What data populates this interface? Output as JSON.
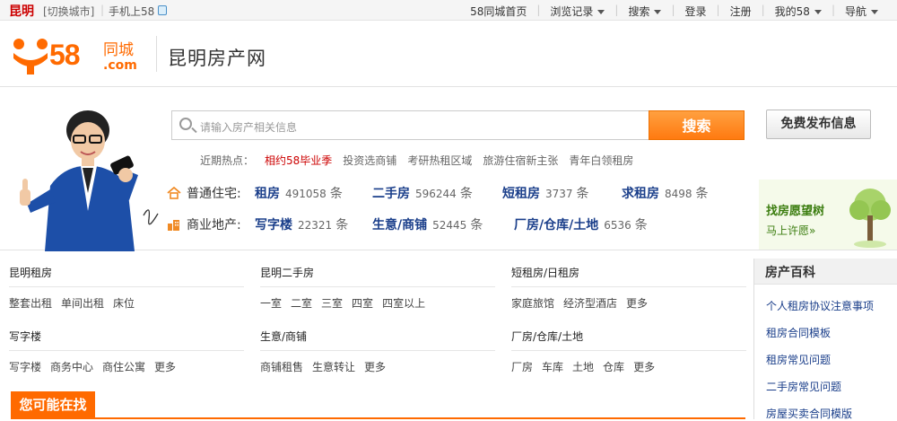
{
  "topbar": {
    "city": "昆明",
    "switch_city": "[切换城市]",
    "mobile": "手机上58",
    "right_items": [
      {
        "label": "58同城首页",
        "caret": false
      },
      {
        "label": "浏览记录",
        "caret": true
      },
      {
        "label": "搜索",
        "caret": true
      },
      {
        "label": "登录",
        "caret": false
      },
      {
        "label": "注册",
        "caret": false
      },
      {
        "label": "我的58",
        "caret": true
      },
      {
        "label": "导航",
        "caret": true
      }
    ]
  },
  "header": {
    "logo_brand": "58",
    "logo_cn": "同城",
    "logo_dotcom": ".com",
    "site_title": "昆明房产网"
  },
  "search": {
    "placeholder": "请输入房产相关信息",
    "button": "搜索",
    "post_button": "免费发布信息"
  },
  "hot": {
    "label": "近期热点：",
    "items": [
      "相约58毕业季",
      "投资选商铺",
      "考研热租区域",
      "旅游住宿新主张",
      "青年白领租房"
    ]
  },
  "categories": [
    {
      "name": "普通住宅:",
      "entries": [
        {
          "name": "租房",
          "count": "491058",
          "unit": "条"
        },
        {
          "name": "二手房",
          "count": "596244",
          "unit": "条"
        },
        {
          "name": "短租房",
          "count": "3737",
          "unit": "条"
        },
        {
          "name": "求租房",
          "count": "8498",
          "unit": "条"
        }
      ]
    },
    {
      "name": "商业地产:",
      "entries": [
        {
          "name": "写字楼",
          "count": "22321",
          "unit": "条"
        },
        {
          "name": "生意/商铺",
          "count": "52445",
          "unit": "条"
        },
        {
          "name": "厂房/仓库/土地",
          "count": "6536",
          "unit": "条"
        }
      ]
    }
  ],
  "wish": {
    "title": "找房愿望树",
    "link": "马上许愿»"
  },
  "sections": [
    {
      "title": "昆明租房",
      "links": [
        "整套出租",
        "单间出租",
        "床位"
      ]
    },
    {
      "title": "昆明二手房",
      "links": [
        "一室",
        "二室",
        "三室",
        "四室",
        "四室以上"
      ]
    },
    {
      "title": "短租房/日租房",
      "links": [
        "家庭旅馆",
        "经济型酒店",
        "更多"
      ]
    },
    {
      "title": "写字楼",
      "links": [
        "写字楼",
        "商务中心",
        "商住公寓",
        "更多"
      ]
    },
    {
      "title": "生意/商铺",
      "links": [
        "商铺租售",
        "生意转让",
        "更多"
      ]
    },
    {
      "title": "厂房/仓库/土地",
      "links": [
        "厂房",
        "车库",
        "土地",
        "仓库",
        "更多"
      ]
    }
  ],
  "you_may": "您可能在找",
  "baike": {
    "title": "房产百科",
    "items": [
      "个人租房协议注意事项",
      "租房合同模板",
      "租房常见问题",
      "二手房常见问题",
      "房屋买卖合同模版"
    ]
  },
  "colors": {
    "brand_orange": "#ff6a00",
    "link_blue": "#1a3e8a",
    "hot_red": "#cc0000"
  }
}
